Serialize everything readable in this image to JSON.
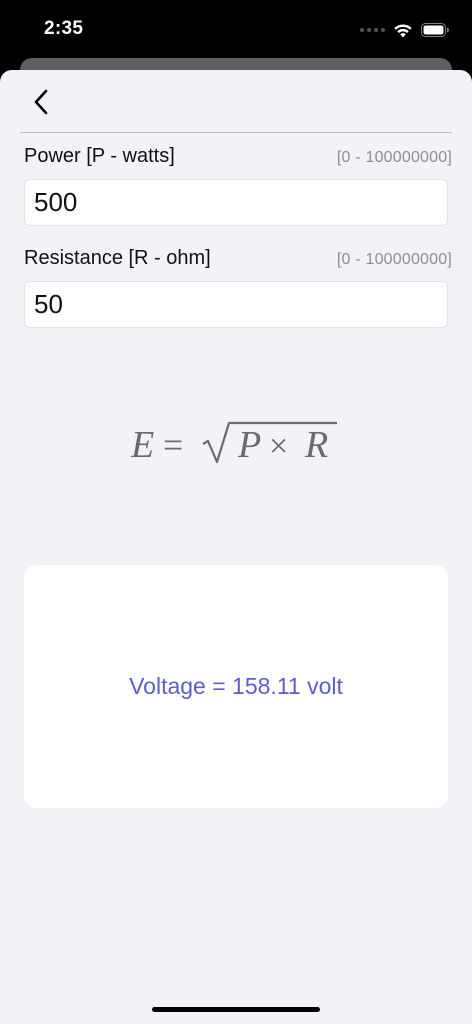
{
  "status_bar": {
    "time": "2:35",
    "icons": [
      "cellular-dots-icon",
      "wifi-icon",
      "battery-icon"
    ]
  },
  "nav": {
    "back_icon": "chevron-left-icon"
  },
  "power": {
    "label": "Power [P - watts]",
    "range": "[0 - 100000000]",
    "value": "500"
  },
  "resistance": {
    "label": "Resistance [R - ohm]",
    "range": "[0 - 100000000]",
    "value": "50"
  },
  "formula": {
    "lhs": "E",
    "equals": "=",
    "var1": "P",
    "times": "×",
    "var2": "R"
  },
  "result": {
    "text": "Voltage = 158.11 volt"
  },
  "colors": {
    "accent": "#5e5ccf",
    "background": "#f2f2f7",
    "formula": "#6b6b6b"
  }
}
